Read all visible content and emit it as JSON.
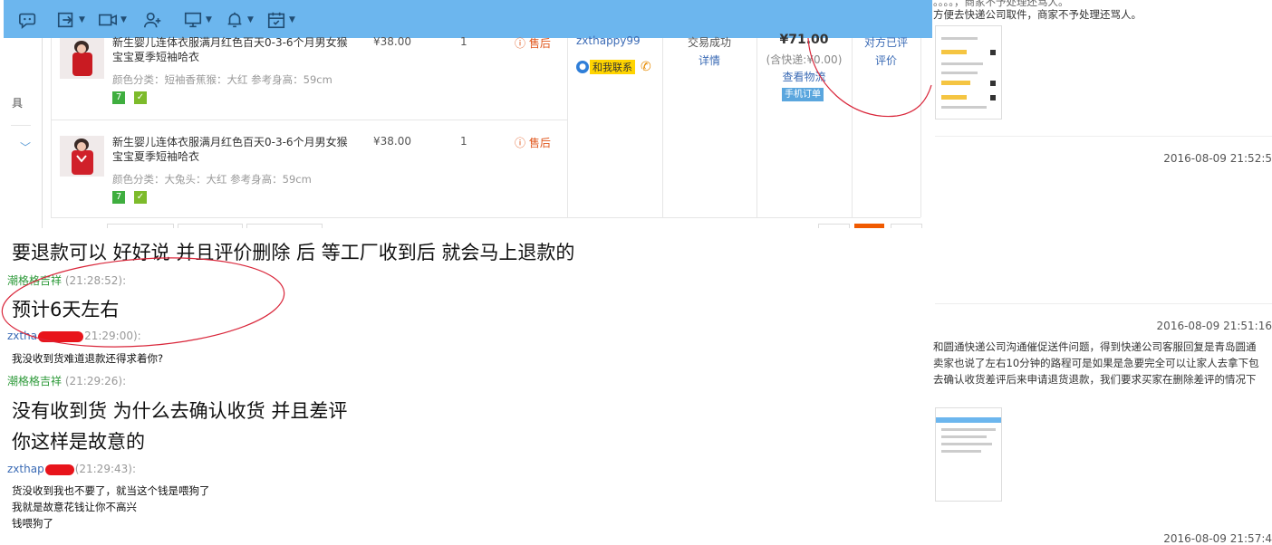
{
  "toolbar": {
    "icons": [
      "emoticon-chat-icon",
      "send-file-icon",
      "video-call-icon",
      "add-contact-icon",
      "screen-share-icon",
      "reminder-bell-icon",
      "schedule-calendar-icon"
    ]
  },
  "order": {
    "side_label": "具",
    "items": [
      {
        "title": "新生婴儿连体衣服满月红色百天0-3-6个月男女猴宝宝夏季短袖哈衣",
        "attr": "颜色分类：短袖香蕉猴：大红   参考身高：59cm",
        "price": "¥38.00",
        "qty": "1",
        "after_sale": "售后"
      },
      {
        "title": "新生婴儿连体衣服满月红色百天0-3-6个月男女猴宝宝夏季短袖哈衣",
        "attr": "颜色分类：大兔头：大红   参考身高：59cm",
        "price": "¥38.00",
        "qty": "1",
        "after_sale": "售后"
      }
    ],
    "buyer": "zxthappy99",
    "contact_label": "和我联系",
    "status": "交易成功",
    "details_link": "详情",
    "total": "¥71.00",
    "shipping": "(含快递:¥0.00)",
    "logistics_link": "查看物流",
    "mobile_badge": "手机订单",
    "review_status": "对方已评",
    "review_link": "评价"
  },
  "chat": {
    "line1": "要退款可以 好好说 并且评价删除 后 等工厂收到后 就会马上退款的",
    "msg1_nick": "潮格格吉祥",
    "msg1_time": "(21:28:52):",
    "msg1_text": "预计6天左右",
    "msg2_nick": "zxtha",
    "msg2_time": "21:29:00):",
    "msg2_text": "我没收到货难道退款还得求着你?",
    "msg3_nick": "潮格格吉祥",
    "msg3_time": "(21:29:26):",
    "msg3_line1": "没有收到货 为什么去确认收货 并且差评",
    "msg3_line2": "你这样是故意的",
    "msg4_nick": "zxthap",
    "msg4_time": "(21:29:43):",
    "msg4_lines": [
      "货没收到我也不要了，就当这个钱是喂狗了",
      "我就是故意花钱让你不高兴",
      "钱喂狗了"
    ]
  },
  "right": {
    "top_text1": "。。。。，商家不予处理还骂人。",
    "top_text2": "方便去快递公司取件，商家不予处理还骂人。",
    "ts1": "2016-08-09 21:52:5",
    "ts2": "2016-08-09 21:51:16",
    "para": [
      "和圆通快递公司沟通催促送件问题，得到快递公司客服回复是青岛圆通",
      "卖家也说了左右10分钟的路程可是如果是急要完全可以让家人去拿下包",
      "去确认收货差评后来申请退货退款，我们要求买家在删除差评的情况下"
    ],
    "ts3": "2016-08-09 21:57:4"
  },
  "colors": {
    "toolbar": "#6cb6ee",
    "accent_red": "#e0571d",
    "annotation_red": "#d9263a",
    "nick_green": "#2e9a3a",
    "nick_blue": "#3b6bb5"
  }
}
